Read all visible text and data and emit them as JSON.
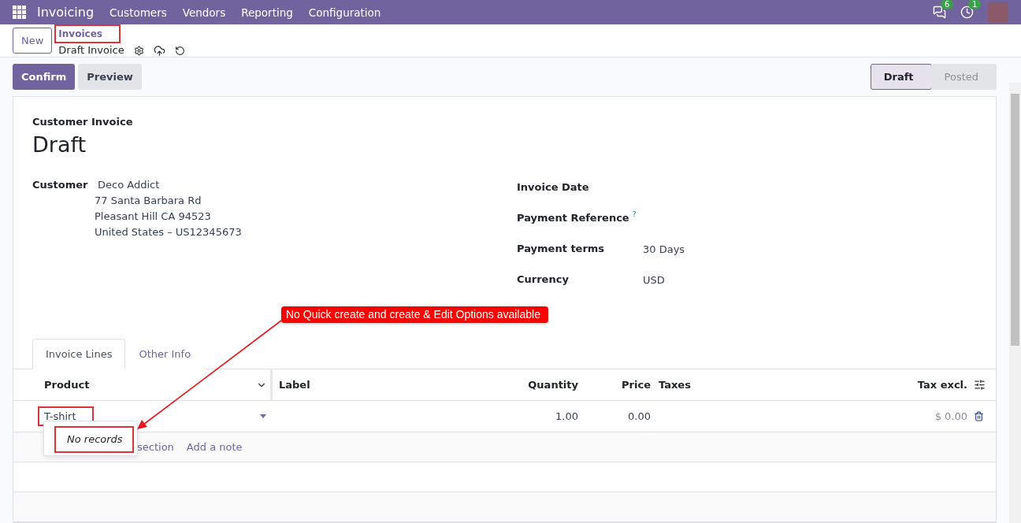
{
  "nav": {
    "app": "Invoicing",
    "menu": [
      "Customers",
      "Vendors",
      "Reporting",
      "Configuration"
    ],
    "messages_count": "6",
    "activities_count": "1"
  },
  "breadcrumb": {
    "new_button": "New",
    "parent": "Invoices",
    "current": "Draft Invoice"
  },
  "actions": [
    {
      "label": "Confirm",
      "kind": "primary"
    },
    {
      "label": "Preview",
      "kind": "secondary"
    }
  ],
  "status_steps": [
    {
      "label": "Draft",
      "selected": true
    },
    {
      "label": "Posted",
      "selected": false
    }
  ],
  "form": {
    "type_label": "Customer Invoice",
    "title": "Draft",
    "customer_label": "Customer",
    "customer_name": "Deco Addict",
    "address_lines": [
      "77 Santa Barbara Rd",
      "Pleasant Hill CA 94523",
      "United States – US12345673"
    ],
    "right_fields": [
      {
        "label": "Invoice Date"
      },
      {
        "label": "Payment Reference",
        "help": "?"
      },
      {
        "label": "Payment terms",
        "value": "30 Days"
      },
      {
        "label": "Currency",
        "value": "USD"
      }
    ]
  },
  "tabs": [
    {
      "label": "Invoice Lines",
      "selected": true
    },
    {
      "label": "Other Info",
      "selected": false
    }
  ],
  "table": {
    "columns": [
      "Product",
      "Label",
      "Quantity",
      "Price",
      "Taxes",
      "Tax excl."
    ],
    "rows": [
      {
        "product": "T-shirt",
        "quantity": "1.00",
        "price": "0.00",
        "tax_excl": "$ 0.00"
      }
    ],
    "add_links": [
      "section",
      "Add a note"
    ]
  },
  "dropdown": {
    "message": "No records"
  },
  "annotation": {
    "callout": "No Quick create and create & Edit Options available"
  }
}
